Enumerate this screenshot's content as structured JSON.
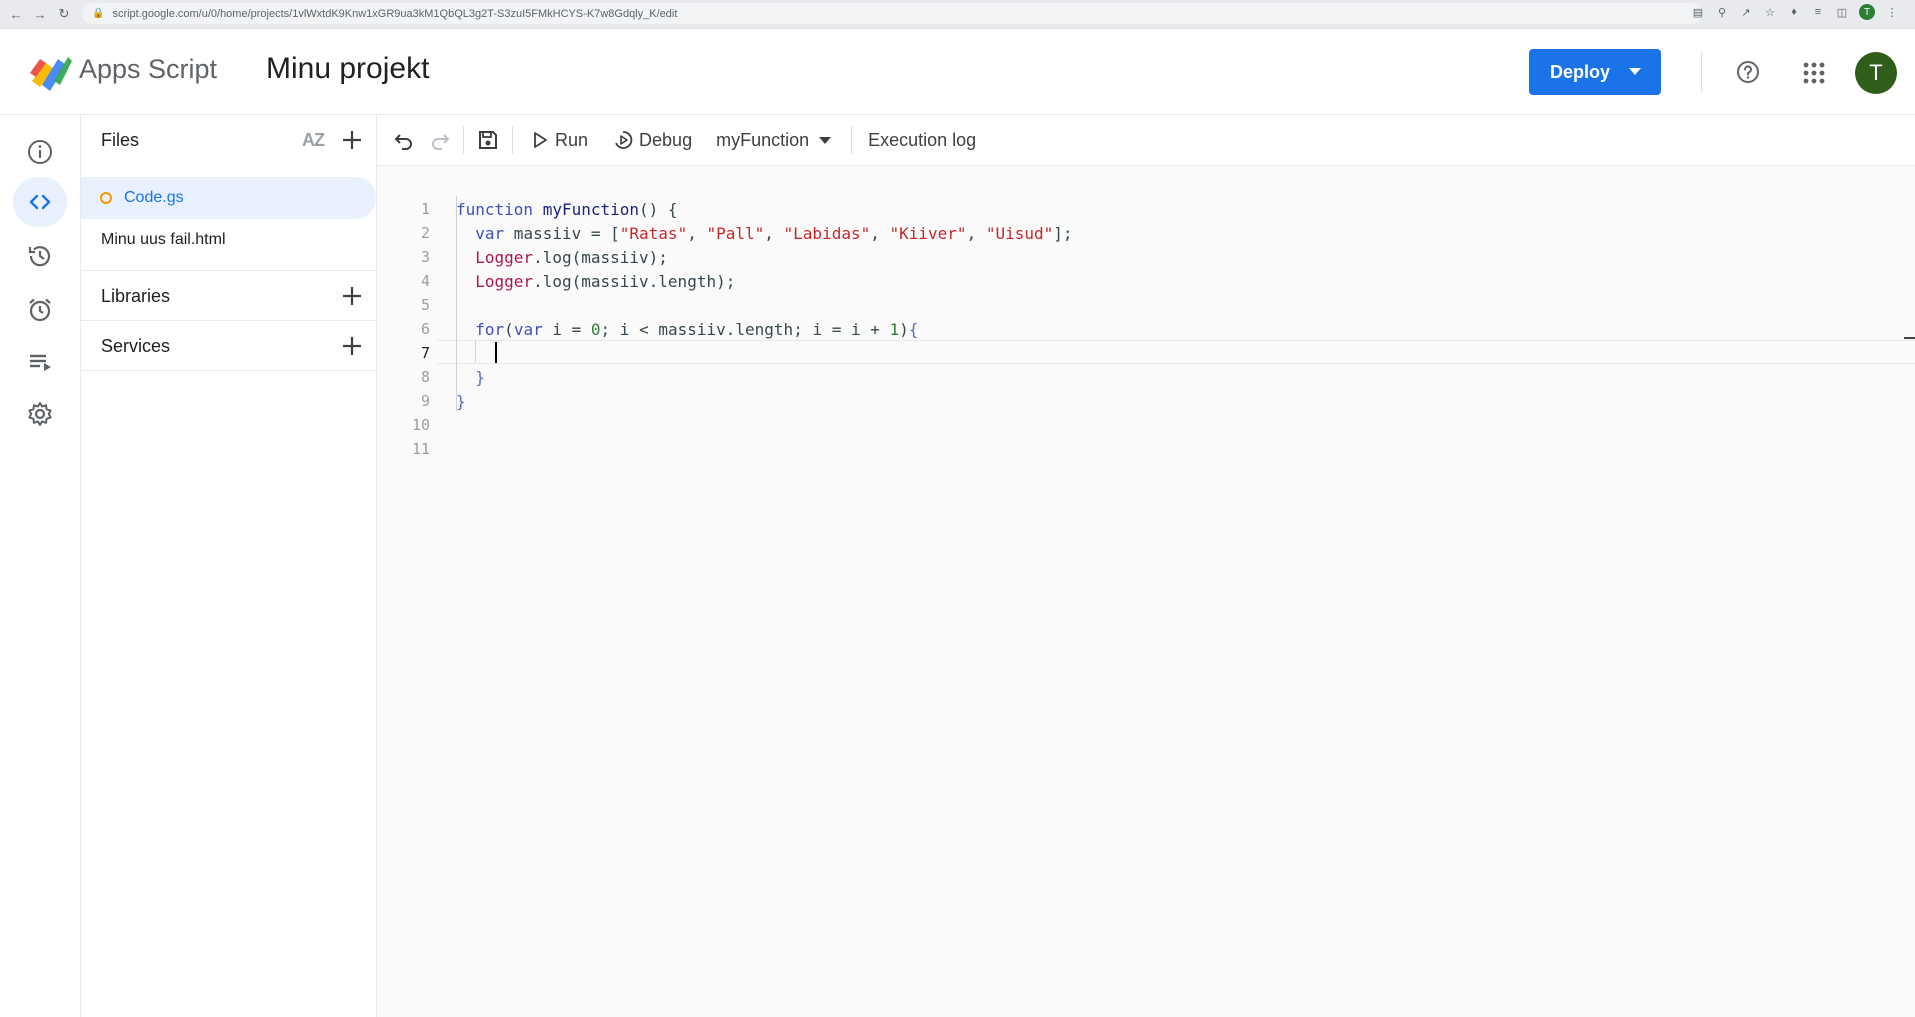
{
  "browser": {
    "url": "script.google.com/u/0/home/projects/1vlWxtdK9Knw1xGR9ua3kM1QbQL3g2T-S3zuI5FMkHCYS-K7w8Gdqly_K/edit",
    "profile_initial": "T"
  },
  "header": {
    "app_name": "Apps Script",
    "project_name": "Minu projekt",
    "deploy_label": "Deploy",
    "avatar_initial": "T"
  },
  "rail": {
    "items": [
      {
        "icon": "info-icon"
      },
      {
        "icon": "code-icon",
        "active": true
      },
      {
        "icon": "history-icon"
      },
      {
        "icon": "alarm-clock-icon"
      },
      {
        "icon": "executions-icon"
      },
      {
        "icon": "gear-icon"
      }
    ]
  },
  "files_panel": {
    "title": "Files",
    "sort_label": "AZ",
    "files": [
      {
        "name": "Code.gs",
        "selected": true
      },
      {
        "name": "Minu uus fail.html",
        "selected": false
      }
    ],
    "libraries_label": "Libraries",
    "services_label": "Services"
  },
  "toolbar": {
    "run_label": "Run",
    "debug_label": "Debug",
    "function_name": "myFunction",
    "execution_log_label": "Execution log"
  },
  "editor": {
    "current_line": 7,
    "lines": [
      {
        "n": "1",
        "text": "function myFunction() {"
      },
      {
        "n": "2",
        "text": "  var massiiv = [\"Ratas\", \"Pall\", \"Labidas\", \"Kiiver\", \"Uisud\"];"
      },
      {
        "n": "3",
        "text": "  Logger.log(massiiv);"
      },
      {
        "n": "4",
        "text": "  Logger.log(massiiv.length);"
      },
      {
        "n": "5",
        "text": ""
      },
      {
        "n": "6",
        "text": "  for(var i = 0; i < massiiv.length; i = i + 1){"
      },
      {
        "n": "7",
        "text": "    "
      },
      {
        "n": "8",
        "text": "  }"
      },
      {
        "n": "9",
        "text": "}"
      },
      {
        "n": "10",
        "text": ""
      },
      {
        "n": "11",
        "text": ""
      }
    ],
    "colors": {
      "keyword": "#3f51b5",
      "string": "#c62828",
      "object": "#ad1457",
      "number": "#2e7d32"
    }
  }
}
